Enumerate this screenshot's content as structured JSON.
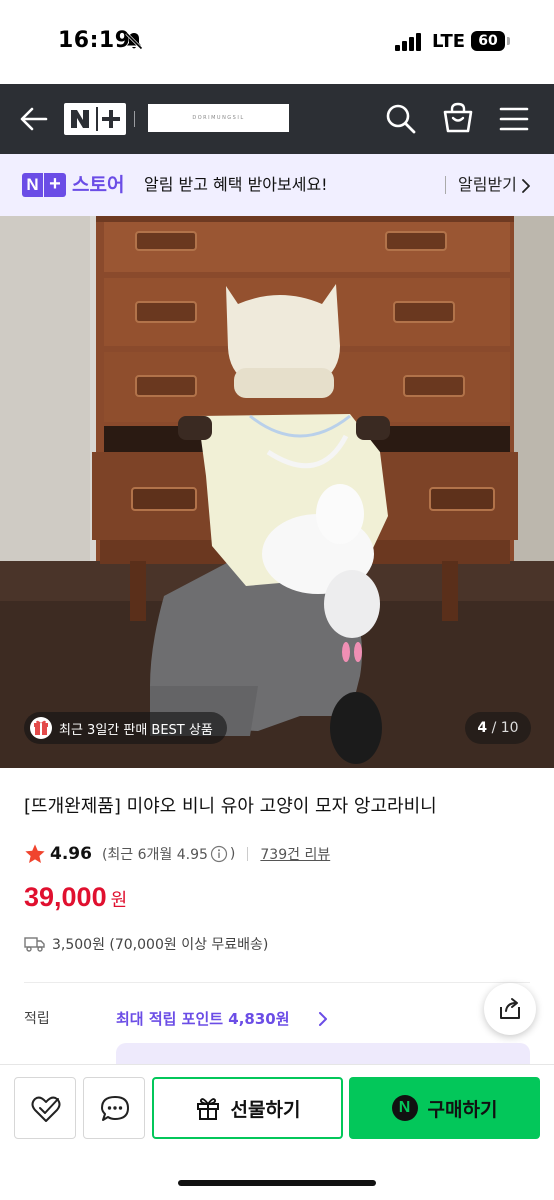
{
  "status_bar": {
    "time": "16:19",
    "network": "LTE",
    "battery": "60",
    "icons": [
      "bell-off-icon",
      "signal-icon",
      "battery-icon"
    ]
  },
  "header": {
    "logo": "N+",
    "store_banner_text": "DORIMUNGSIL",
    "icons": [
      "back-arrow-icon",
      "search-icon",
      "shopping-bag-icon",
      "menu-icon"
    ]
  },
  "notify_banner": {
    "badge": "N+",
    "store_label": "스토어",
    "message": "알림 받고 혜택 받아보세요!",
    "action": "알림받기"
  },
  "gallery": {
    "badge": "최근 3일간 판매 BEST 상품",
    "current": "4",
    "total": "/ 10"
  },
  "product": {
    "title": "[뜨개완제품] 미야오 비니 유아 고양이 모자 앙고라비니",
    "rating": "4.96",
    "recent_rating": "(최근 6개월 4.95",
    "recent_rating_close": ")",
    "reviews": "739건 리뷰",
    "price": "39,000",
    "price_unit": "원",
    "shipping": "3,500원 (70,000원 이상 무료배송)"
  },
  "points": {
    "label": "적립",
    "value": "최대 적립 포인트 4,830원"
  },
  "action_bar": {
    "gift_label": "선물하기",
    "buy_label": "구매하기",
    "npay_mark": "N"
  },
  "colors": {
    "header_bg": "#2c2f34",
    "brand_purple": "#6b4de6",
    "price_red": "#e0102f",
    "naver_green": "#03c75a",
    "banner_bg": "#f1efff"
  }
}
